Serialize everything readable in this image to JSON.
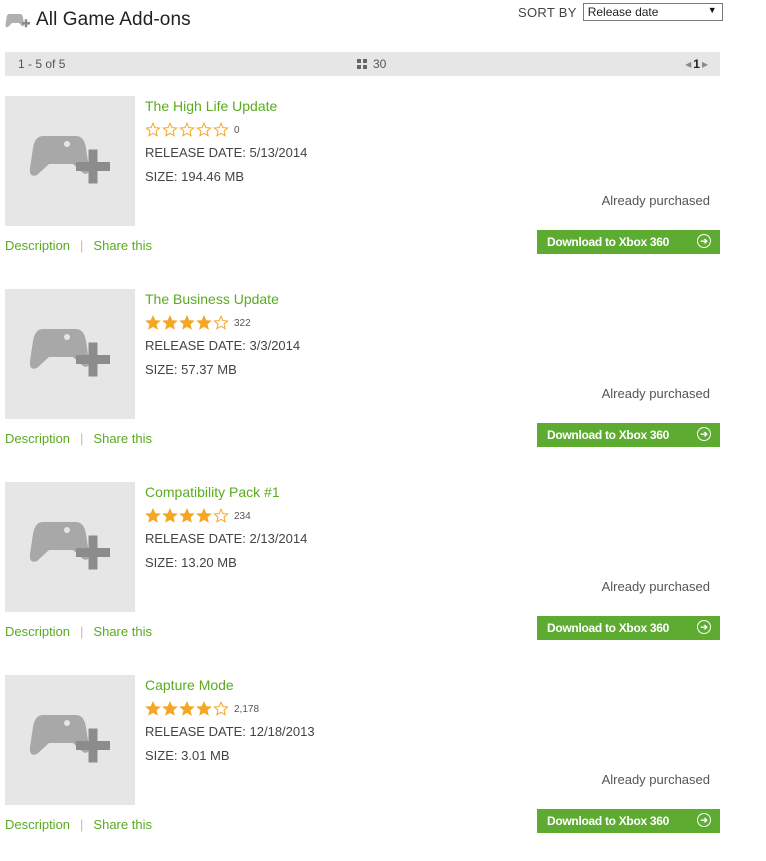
{
  "header": {
    "title": "All Game Add-ons",
    "icon": "gamepad-plus-icon"
  },
  "sort": {
    "label": "SORT BY",
    "selected": "Release date"
  },
  "pager": {
    "range": "1 - 5 of 5",
    "per_page": "30",
    "page": "1"
  },
  "colors": {
    "accent": "#5aab1f",
    "button": "#5dab30",
    "star": "#f5a623"
  },
  "items": [
    {
      "name": "The High Life Update",
      "stars": 0,
      "rating_count": "0",
      "release": "RELEASE DATE: 5/13/2014",
      "size": "SIZE: 194.46 MB",
      "status": "Already purchased",
      "desc": "Description",
      "share": "Share this",
      "download": "Download to Xbox 360"
    },
    {
      "name": "The Business Update",
      "stars": 4,
      "rating_count": "322",
      "release": "RELEASE DATE: 3/3/2014",
      "size": "SIZE: 57.37 MB",
      "status": "Already purchased",
      "desc": "Description",
      "share": "Share this",
      "download": "Download to Xbox 360"
    },
    {
      "name": "Compatibility Pack #1",
      "stars": 4,
      "rating_count": "234",
      "release": "RELEASE DATE: 2/13/2014",
      "size": "SIZE: 13.20 MB",
      "status": "Already purchased",
      "desc": "Description",
      "share": "Share this",
      "download": "Download to Xbox 360"
    },
    {
      "name": "Capture Mode",
      "stars": 4,
      "rating_count": "2,178",
      "release": "RELEASE DATE: 12/18/2013",
      "size": "SIZE: 3.01 MB",
      "status": "Already purchased",
      "desc": "Description",
      "share": "Share this",
      "download": "Download to Xbox 360"
    }
  ]
}
